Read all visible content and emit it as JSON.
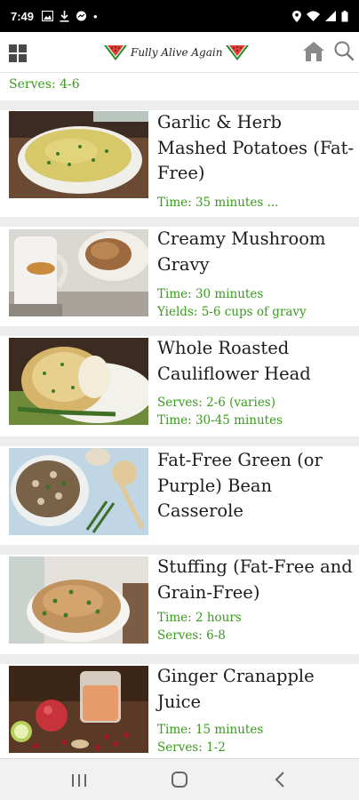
{
  "status_bar": {
    "time": "7:49",
    "dot": "•"
  },
  "header": {
    "logo_text": "Fully Alive Again",
    "icons": [
      "grid-menu-icon",
      "watermelon-icon",
      "home-icon",
      "search-icon"
    ]
  },
  "previous_item": {
    "meta": "Serves: 4-6"
  },
  "recipes": [
    {
      "title": "Garlic & Herb Mashed Potatoes (Fat-Free)",
      "meta1": "Time: 35 minutes ...",
      "meta2": ""
    },
    {
      "title": "Creamy Mushroom Gravy",
      "meta1": "Time: 30 minutes",
      "meta2": "Yields: 5-6 cups of gravy"
    },
    {
      "title": "Whole Roasted Cauliflower Head",
      "meta1": "Serves: 2-6 (varies)",
      "meta2": "Time: 30-45 minutes"
    },
    {
      "title": "Fat-Free Green (or Purple) Bean Casserole",
      "meta1": "",
      "meta2": ""
    },
    {
      "title": "Stuffing (Fat-Free and Grain-Free)",
      "meta1": "Time: 2 hours",
      "meta2": "Serves: 6-8"
    },
    {
      "title": "Ginger Cranapple Juice",
      "meta1": "Time: 15 minutes",
      "meta2": "Serves: 1-2"
    }
  ],
  "colors": {
    "accent_green": "#3a9a1e",
    "text": "#1c1c1c",
    "background": "#ededed"
  },
  "nav_bar": {
    "icons": [
      "recent-apps-icon",
      "home-button-icon",
      "back-icon"
    ]
  }
}
